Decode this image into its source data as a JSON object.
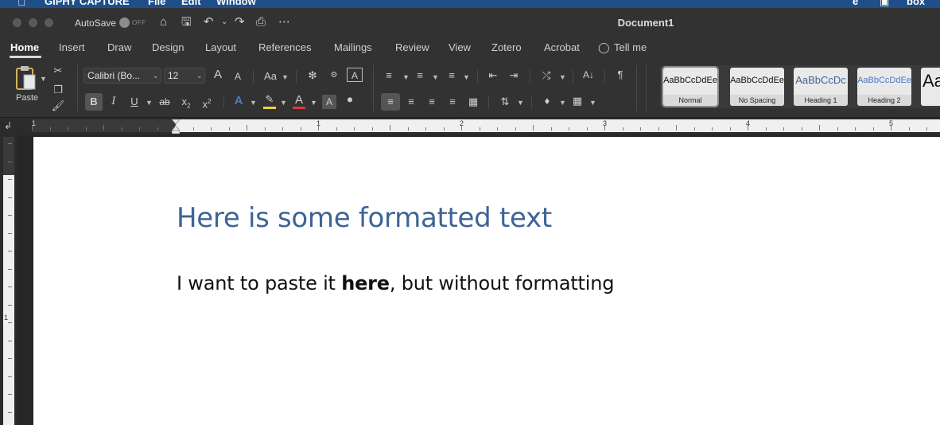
{
  "mac_menubar": {
    "items": [
      "GIPHY CAPTURE",
      "File",
      "Edit",
      "Window"
    ],
    "right_text": "box"
  },
  "titlebar": {
    "autosave_label": "AutoSave",
    "autosave_state": "OFF",
    "document_title": "Document1"
  },
  "ribbon_tabs": [
    "Home",
    "Insert",
    "Draw",
    "Design",
    "Layout",
    "References",
    "Mailings",
    "Review",
    "View",
    "Zotero",
    "Acrobat"
  ],
  "tell_me": "Tell me",
  "clipboard": {
    "paste_label": "Paste"
  },
  "font": {
    "name": "Calibri (Bo...",
    "size": "12",
    "grow": "A",
    "shrink": "A",
    "change_case": "Aa",
    "bold": "B",
    "italic": "I",
    "underline": "U",
    "strike": "ab",
    "subscript": "x",
    "superscript": "x",
    "highlight_color": "#f2d13a",
    "font_color": "#e03a3a",
    "effects_color": "#4a78c8"
  },
  "styles": [
    {
      "sample": "AaBbCcDdEe",
      "name": "Normal",
      "color": "#111111"
    },
    {
      "sample": "AaBbCcDdEe",
      "name": "No Spacing",
      "color": "#111111"
    },
    {
      "sample": "AaBbCcDc",
      "name": "Heading 1",
      "color": "#3e6496"
    },
    {
      "sample": "AaBbCcDdEe",
      "name": "Heading 2",
      "color": "#4a78c8"
    },
    {
      "sample": "Aa",
      "name": "",
      "color": "#111111"
    }
  ],
  "ruler": {
    "numbers": [
      "1",
      "1",
      "2",
      "3",
      "4",
      "5"
    ]
  },
  "document": {
    "heading": "Here is some formatted text",
    "body_before": "I want to paste it ",
    "body_bold": "here",
    "body_after": ", but without formatting"
  }
}
